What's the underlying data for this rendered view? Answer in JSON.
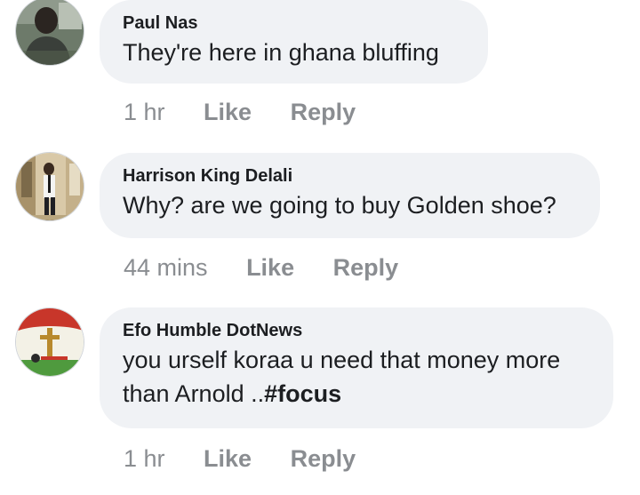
{
  "comments": [
    {
      "author": "Paul Nas",
      "text": "They're here in ghana bluffing",
      "time": "1 hr",
      "like_label": "Like",
      "reply_label": "Reply",
      "avatar_icon": "person-photo-avatar"
    },
    {
      "author": "Harrison King Delali",
      "text": "Why? are we going to buy Golden shoe?",
      "time": "44 mins",
      "like_label": "Like",
      "reply_label": "Reply",
      "avatar_icon": "person-standing-photo-avatar"
    },
    {
      "author": "Efo Humble DotNews",
      "text_line1": "you urself koraa u need that money more",
      "text_line2": "than Arnold ..",
      "hashtag": "#focus",
      "time": "1 hr",
      "like_label": "Like",
      "reply_label": "Reply",
      "avatar_icon": "cross-logo-avatar"
    }
  ],
  "colors": {
    "bubble_bg": "#f0f2f5",
    "text": "#1c1e21",
    "meta": "#8a8d91"
  }
}
